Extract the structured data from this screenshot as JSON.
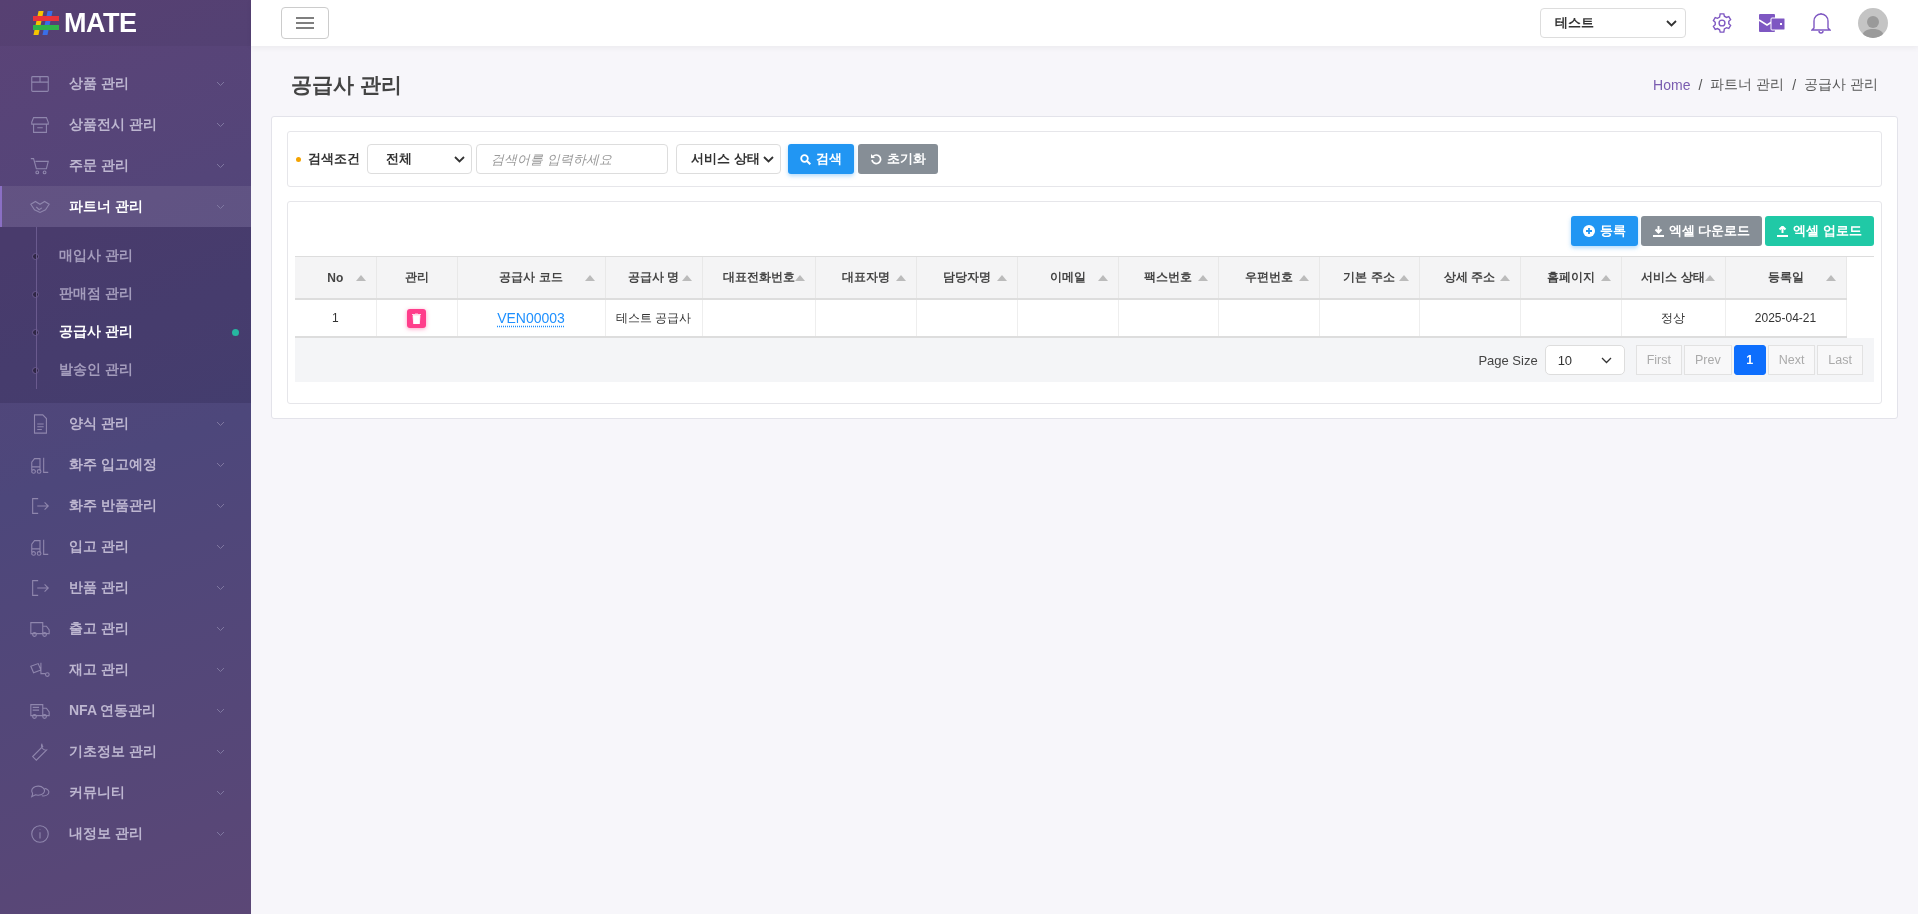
{
  "logo": {
    "text": "MATE"
  },
  "sidebar": {
    "items": [
      {
        "label": "상품 관리",
        "expanded": false
      },
      {
        "label": "상품전시 관리",
        "expanded": false
      },
      {
        "label": "주문 관리",
        "expanded": false
      },
      {
        "label": "파트너 관리",
        "expanded": true,
        "children": [
          {
            "label": "매입사 관리",
            "selected": false
          },
          {
            "label": "판매점 관리",
            "selected": false
          },
          {
            "label": "공급사 관리",
            "selected": true
          },
          {
            "label": "발송인 관리",
            "selected": false
          }
        ]
      },
      {
        "label": "양식 관리",
        "expanded": false
      },
      {
        "label": "화주 입고예정",
        "expanded": false
      },
      {
        "label": "화주 반품관리",
        "expanded": false
      },
      {
        "label": "입고 관리",
        "expanded": false
      },
      {
        "label": "반품 관리",
        "expanded": false
      },
      {
        "label": "출고 관리",
        "expanded": false
      },
      {
        "label": "재고 관리",
        "expanded": false
      },
      {
        "label": "NFA 연동관리",
        "expanded": false
      },
      {
        "label": "기초정보 관리",
        "expanded": false
      },
      {
        "label": "커뮤니티",
        "expanded": false
      },
      {
        "label": "내정보 관리",
        "expanded": false
      }
    ]
  },
  "header": {
    "company_select": "테스트"
  },
  "page": {
    "title": "공급사 관리",
    "breadcrumb_separator": "/",
    "breadcrumb": [
      {
        "label": "Home",
        "kind": "link"
      },
      {
        "label": "파트너 관리",
        "kind": "text"
      },
      {
        "label": "공급사 관리",
        "kind": "text"
      }
    ]
  },
  "search": {
    "label": "검색조건",
    "condition": "전체",
    "placeholder": "검색어를 입력하세요",
    "status": "서비스 상태",
    "search_button": "검색",
    "reset_button": "초기화"
  },
  "actions": [
    {
      "label": "등록",
      "kind": "add"
    },
    {
      "label": "엑셀 다운로드",
      "kind": "download"
    },
    {
      "label": "엑셀 업로드",
      "kind": "upload"
    }
  ],
  "table": {
    "columns": [
      {
        "label": "No",
        "sortable": true
      },
      {
        "label": "관리",
        "sortable": false
      },
      {
        "label": "공급사 코드",
        "sortable": true
      },
      {
        "label": "공급사 명",
        "sortable": true
      },
      {
        "label": "대표전화번호",
        "sortable": true
      },
      {
        "label": "대표자명",
        "sortable": true
      },
      {
        "label": "담당자명",
        "sortable": true
      },
      {
        "label": "이메일",
        "sortable": true
      },
      {
        "label": "팩스번호",
        "sortable": true
      },
      {
        "label": "우편번호",
        "sortable": true
      },
      {
        "label": "기본 주소",
        "sortable": true
      },
      {
        "label": "상세 주소",
        "sortable": true
      },
      {
        "label": "홈페이지",
        "sortable": true
      },
      {
        "label": "서비스 상태",
        "sortable": true
      },
      {
        "label": "등록일",
        "sortable": true
      }
    ],
    "rows": [
      {
        "cells": [
          {
            "kind": "text",
            "text": "1"
          },
          {
            "kind": "delete"
          },
          {
            "kind": "link",
            "text": "VEN00003"
          },
          {
            "kind": "text",
            "text": "테스트 공급사"
          },
          {
            "kind": "empty"
          },
          {
            "kind": "empty"
          },
          {
            "kind": "empty"
          },
          {
            "kind": "empty"
          },
          {
            "kind": "empty"
          },
          {
            "kind": "empty"
          },
          {
            "kind": "empty"
          },
          {
            "kind": "empty"
          },
          {
            "kind": "empty"
          },
          {
            "kind": "text",
            "text": "정상"
          },
          {
            "kind": "text",
            "text": "2025-04-21"
          }
        ]
      }
    ]
  },
  "pagination": {
    "page_size_label": "Page Size",
    "page_size": "10",
    "pages": [
      {
        "label": "First",
        "selected": false,
        "disabled": true
      },
      {
        "label": "Prev",
        "selected": false,
        "disabled": true
      },
      {
        "label": "1",
        "selected": true,
        "disabled": false
      },
      {
        "label": "Next",
        "selected": false,
        "disabled": true
      },
      {
        "label": "Last",
        "selected": false,
        "disabled": true
      }
    ]
  }
}
